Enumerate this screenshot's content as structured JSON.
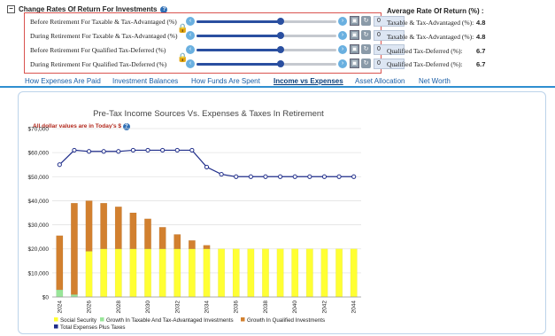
{
  "rates": {
    "header_title": "Change Rates Of Return For Investments",
    "collapse_symbol": "−",
    "help_symbol": "?",
    "rows": [
      {
        "label": "Before Retirement For Taxable & Tax-Advantaged (%)",
        "value": "0",
        "slider_fraction": 0.6,
        "locked": false
      },
      {
        "label": "During Retirement For Taxable & Tax-Advantaged (%)",
        "value": "0",
        "slider_fraction": 0.6,
        "locked": true
      },
      {
        "label": "Before Retirement For Qualified Tax-Deferred (%)",
        "value": "0",
        "slider_fraction": 0.6,
        "locked": false
      },
      {
        "label": "During Retirement For Qualified Tax-Deferred (%)",
        "value": "0",
        "slider_fraction": 0.6,
        "locked": true
      }
    ],
    "lock_glyph": "🔒",
    "arrow_left": "‹",
    "arrow_right": "›",
    "save_glyph": "▣",
    "reset_glyph": "↻"
  },
  "average": {
    "title": "Average Rate Of Return (%) :",
    "rows": [
      {
        "label": "Taxable & Tax-Advantaged (%):",
        "value": "4.8"
      },
      {
        "label": "Taxable & Tax-Advantaged (%):",
        "value": "4.8"
      },
      {
        "label": "Qualified Tax-Deferred (%):",
        "value": "6.7"
      },
      {
        "label": "Qualified Tax-Deferred (%):",
        "value": "6.7"
      }
    ]
  },
  "tabs": [
    {
      "label": "How Expenses Are Paid",
      "active": false
    },
    {
      "label": "Investment Balances",
      "active": false
    },
    {
      "label": "How Funds Are Spent",
      "active": false
    },
    {
      "label": "Income vs Expenses",
      "active": true
    },
    {
      "label": "Asset Allocation",
      "active": false
    },
    {
      "label": "Net Worth",
      "active": false
    }
  ],
  "note": {
    "text": "All dollar values are in Today's $"
  },
  "colors": {
    "social_security": "#ffff33",
    "growth_taxable": "#99e699",
    "growth_qualified": "#d2802f",
    "expenses_line": "#1f2d8a",
    "accent": "#2f8fd0",
    "box_border": "#d9534f"
  },
  "chart_data": {
    "type": "bar",
    "title": "Pre-Tax Income Sources Vs. Expenses & Taxes In Retirement",
    "xlabel": "",
    "ylabel": "",
    "ylim": [
      0,
      70000
    ],
    "yticks": [
      "$0",
      "$10,000",
      "$20,000",
      "$30,000",
      "$40,000",
      "$50,000",
      "$60,000",
      "$70,000"
    ],
    "grid": true,
    "legend_position": "bottom-left",
    "categories": [
      "2024",
      "2025",
      "2026",
      "2027",
      "2028",
      "2029",
      "2030",
      "2031",
      "2032",
      "2033",
      "2034",
      "2035",
      "2036",
      "2037",
      "2038",
      "2039",
      "2040",
      "2041",
      "2042",
      "2043",
      "2044"
    ],
    "xtick_labels": [
      "2024",
      "2026",
      "2028",
      "2030",
      "2032",
      "2034",
      "2036",
      "2038",
      "2040",
      "2042",
      "2044"
    ],
    "series": [
      {
        "name": "Social Security",
        "kind": "stacked-bar",
        "values": [
          0,
          0,
          19000,
          20000,
          20000,
          20000,
          20000,
          20000,
          20000,
          20000,
          20000,
          20000,
          20000,
          20000,
          20000,
          20000,
          20000,
          20000,
          20000,
          20000,
          20000
        ]
      },
      {
        "name": "Growth In Taxable And Tax-Advantaged Investments",
        "kind": "stacked-bar",
        "values": [
          3000,
          1000,
          0,
          0,
          0,
          0,
          0,
          0,
          0,
          0,
          0,
          0,
          0,
          0,
          0,
          0,
          0,
          0,
          0,
          0,
          0
        ]
      },
      {
        "name": "Growth In Qualified Investments",
        "kind": "stacked-bar",
        "values": [
          22500,
          38000,
          21000,
          19000,
          17500,
          15000,
          12500,
          9000,
          6000,
          3500,
          1500,
          0,
          0,
          0,
          0,
          0,
          0,
          0,
          0,
          0,
          0
        ]
      },
      {
        "name": "Total Expenses Plus Taxes",
        "kind": "line",
        "values": [
          55000,
          61000,
          60500,
          60500,
          60500,
          61000,
          61000,
          61000,
          61000,
          61000,
          54000,
          51000,
          50000,
          50000,
          50000,
          50000,
          50000,
          50000,
          50000,
          50000,
          50000
        ]
      }
    ]
  }
}
